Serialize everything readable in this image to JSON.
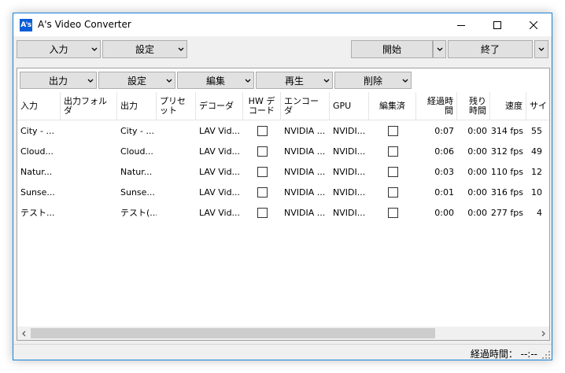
{
  "window": {
    "app_icon_text": "A's",
    "title": "A's Video Converter"
  },
  "toolbar_top": {
    "input_label": "入力",
    "settings_label": "設定",
    "start_label": "開始",
    "end_label": "終了"
  },
  "toolbar_list": {
    "output_label": "出力",
    "settings_label": "設定",
    "edit_label": "編集",
    "play_label": "再生",
    "delete_label": "削除"
  },
  "columns": [
    {
      "label": "入力"
    },
    {
      "label": "出力フォルダ"
    },
    {
      "label": "出力"
    },
    {
      "label": "プリセット"
    },
    {
      "label": "デコーダ"
    },
    {
      "label": "HW デコード"
    },
    {
      "label": "エンコーダ"
    },
    {
      "label": "GPU"
    },
    {
      "label": "編集済"
    },
    {
      "label": "経過時間"
    },
    {
      "label": "残り時間"
    },
    {
      "label": "速度"
    },
    {
      "label": "サイ"
    }
  ],
  "rows": [
    {
      "input": "City - ...",
      "output_folder": "",
      "output": "City - ...",
      "preset": "",
      "decoder": "LAV Vid...",
      "hw": false,
      "encoder": "NVIDIA ...",
      "gpu": "NVIDI...",
      "edited": false,
      "elapsed": "0:07",
      "remaining": "0:00",
      "speed": "314 fps",
      "size": "55"
    },
    {
      "input": "Cloud...",
      "output_folder": "",
      "output": "Cloud...",
      "preset": "",
      "decoder": "LAV Vid...",
      "hw": false,
      "encoder": "NVIDIA ...",
      "gpu": "NVIDI...",
      "edited": false,
      "elapsed": "0:06",
      "remaining": "0:00",
      "speed": "312 fps",
      "size": "49"
    },
    {
      "input": "Natur...",
      "output_folder": "",
      "output": "Natur...",
      "preset": "",
      "decoder": "LAV Vid...",
      "hw": false,
      "encoder": "NVIDIA ...",
      "gpu": "NVIDI...",
      "edited": false,
      "elapsed": "0:03",
      "remaining": "0:00",
      "speed": "110 fps",
      "size": "12"
    },
    {
      "input": "Sunse...",
      "output_folder": "",
      "output": "Sunse...",
      "preset": "",
      "decoder": "LAV Vid...",
      "hw": false,
      "encoder": "NVIDIA ...",
      "gpu": "NVIDI...",
      "edited": false,
      "elapsed": "0:01",
      "remaining": "0:00",
      "speed": "316 fps",
      "size": "10"
    },
    {
      "input": "テスト...",
      "output_folder": "",
      "output": "テスト(...",
      "preset": "",
      "decoder": "LAV Vid...",
      "hw": false,
      "encoder": "NVIDIA ...",
      "gpu": "NVIDI...",
      "edited": false,
      "elapsed": "0:00",
      "remaining": "0:00",
      "speed": "277 fps",
      "size": "4"
    }
  ],
  "status": {
    "elapsed_text": "経過時間： --:--"
  },
  "colors": {
    "window_border": "#1883d7",
    "button_face": "#e1e1e1",
    "app_icon": "#0a5dd8"
  }
}
